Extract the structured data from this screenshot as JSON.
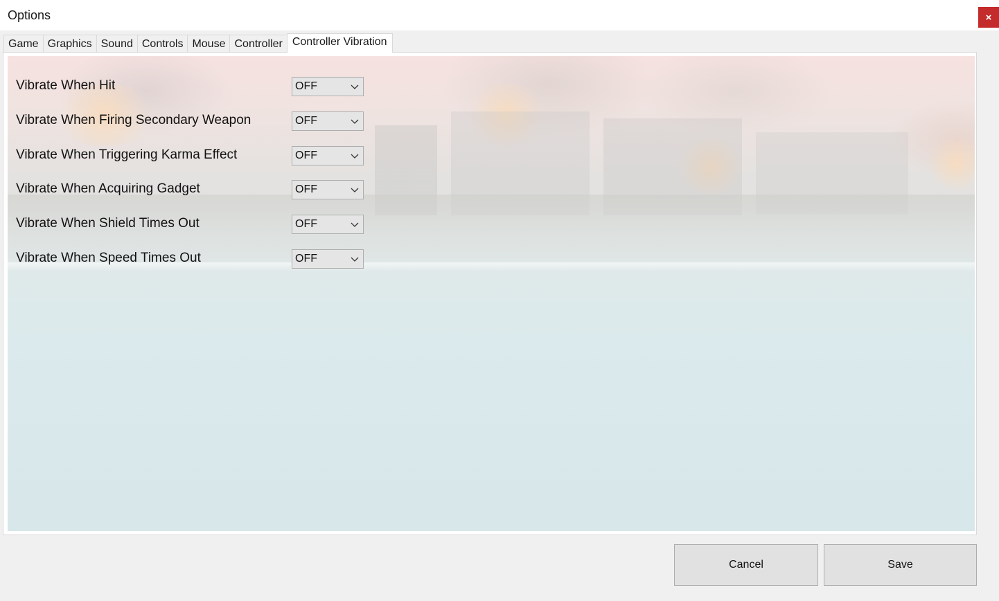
{
  "window": {
    "title": "Options",
    "close_label": "×"
  },
  "tabs": [
    {
      "label": "Game",
      "active": false
    },
    {
      "label": "Graphics",
      "active": false
    },
    {
      "label": "Sound",
      "active": false
    },
    {
      "label": "Controls",
      "active": false
    },
    {
      "label": "Mouse",
      "active": false
    },
    {
      "label": "Controller",
      "active": false
    },
    {
      "label": "Controller Vibration",
      "active": true
    }
  ],
  "settings": [
    {
      "label": "Vibrate When Hit",
      "value": "OFF"
    },
    {
      "label": "Vibrate When Firing Secondary Weapon",
      "value": "OFF"
    },
    {
      "label": "Vibrate When Triggering Karma Effect",
      "value": "OFF"
    },
    {
      "label": "Vibrate When Acquiring Gadget",
      "value": "OFF"
    },
    {
      "label": "Vibrate When Shield Times Out",
      "value": "OFF"
    },
    {
      "label": "Vibrate When Speed Times Out",
      "value": "OFF"
    }
  ],
  "buttons": {
    "cancel_label": "Cancel",
    "save_label": "Save"
  },
  "icons": {
    "close": "close-icon",
    "dropdown": "chevron-down-icon"
  },
  "colors": {
    "close_button": "#c42b2b",
    "window_bg": "#f0f0f0",
    "panel_bg": "#ffffff"
  }
}
